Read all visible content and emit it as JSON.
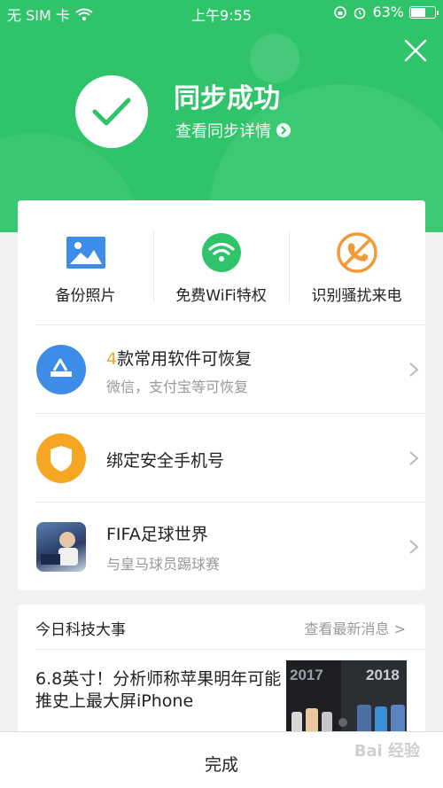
{
  "status": {
    "carrier": "无 SIM 卡",
    "time": "上午9:55",
    "battery": "63%",
    "battery_level": 0.63
  },
  "hero": {
    "title": "同步成功",
    "link": "查看同步详情"
  },
  "quick_actions": [
    {
      "label": "备份照片",
      "icon": "photo-icon"
    },
    {
      "label": "免费WiFi特权",
      "icon": "wifi-icon"
    },
    {
      "label": "识别骚扰来电",
      "icon": "block-call-icon"
    }
  ],
  "rows": {
    "restore": {
      "count": "4",
      "title": "款常用软件可恢复",
      "subtitle": "微信，支付宝等可恢复"
    },
    "bind": {
      "title": "绑定安全手机号"
    },
    "fifa": {
      "title": "FIFA足球世界",
      "subtitle": "与皇马球员踢球赛"
    }
  },
  "news": {
    "header": "今日科技大事",
    "more": "查看最新消息 >",
    "title": "6.8英寸！分析师称苹果明年可能推史上最大屏iPhone",
    "thumb_years": [
      "2017",
      "2018"
    ]
  },
  "footer": {
    "done": "完成",
    "watermark": "Bai 经验"
  },
  "colors": {
    "brand_green": "#2fc46a",
    "blue": "#3d8ce8",
    "orange": "#f5a623"
  }
}
